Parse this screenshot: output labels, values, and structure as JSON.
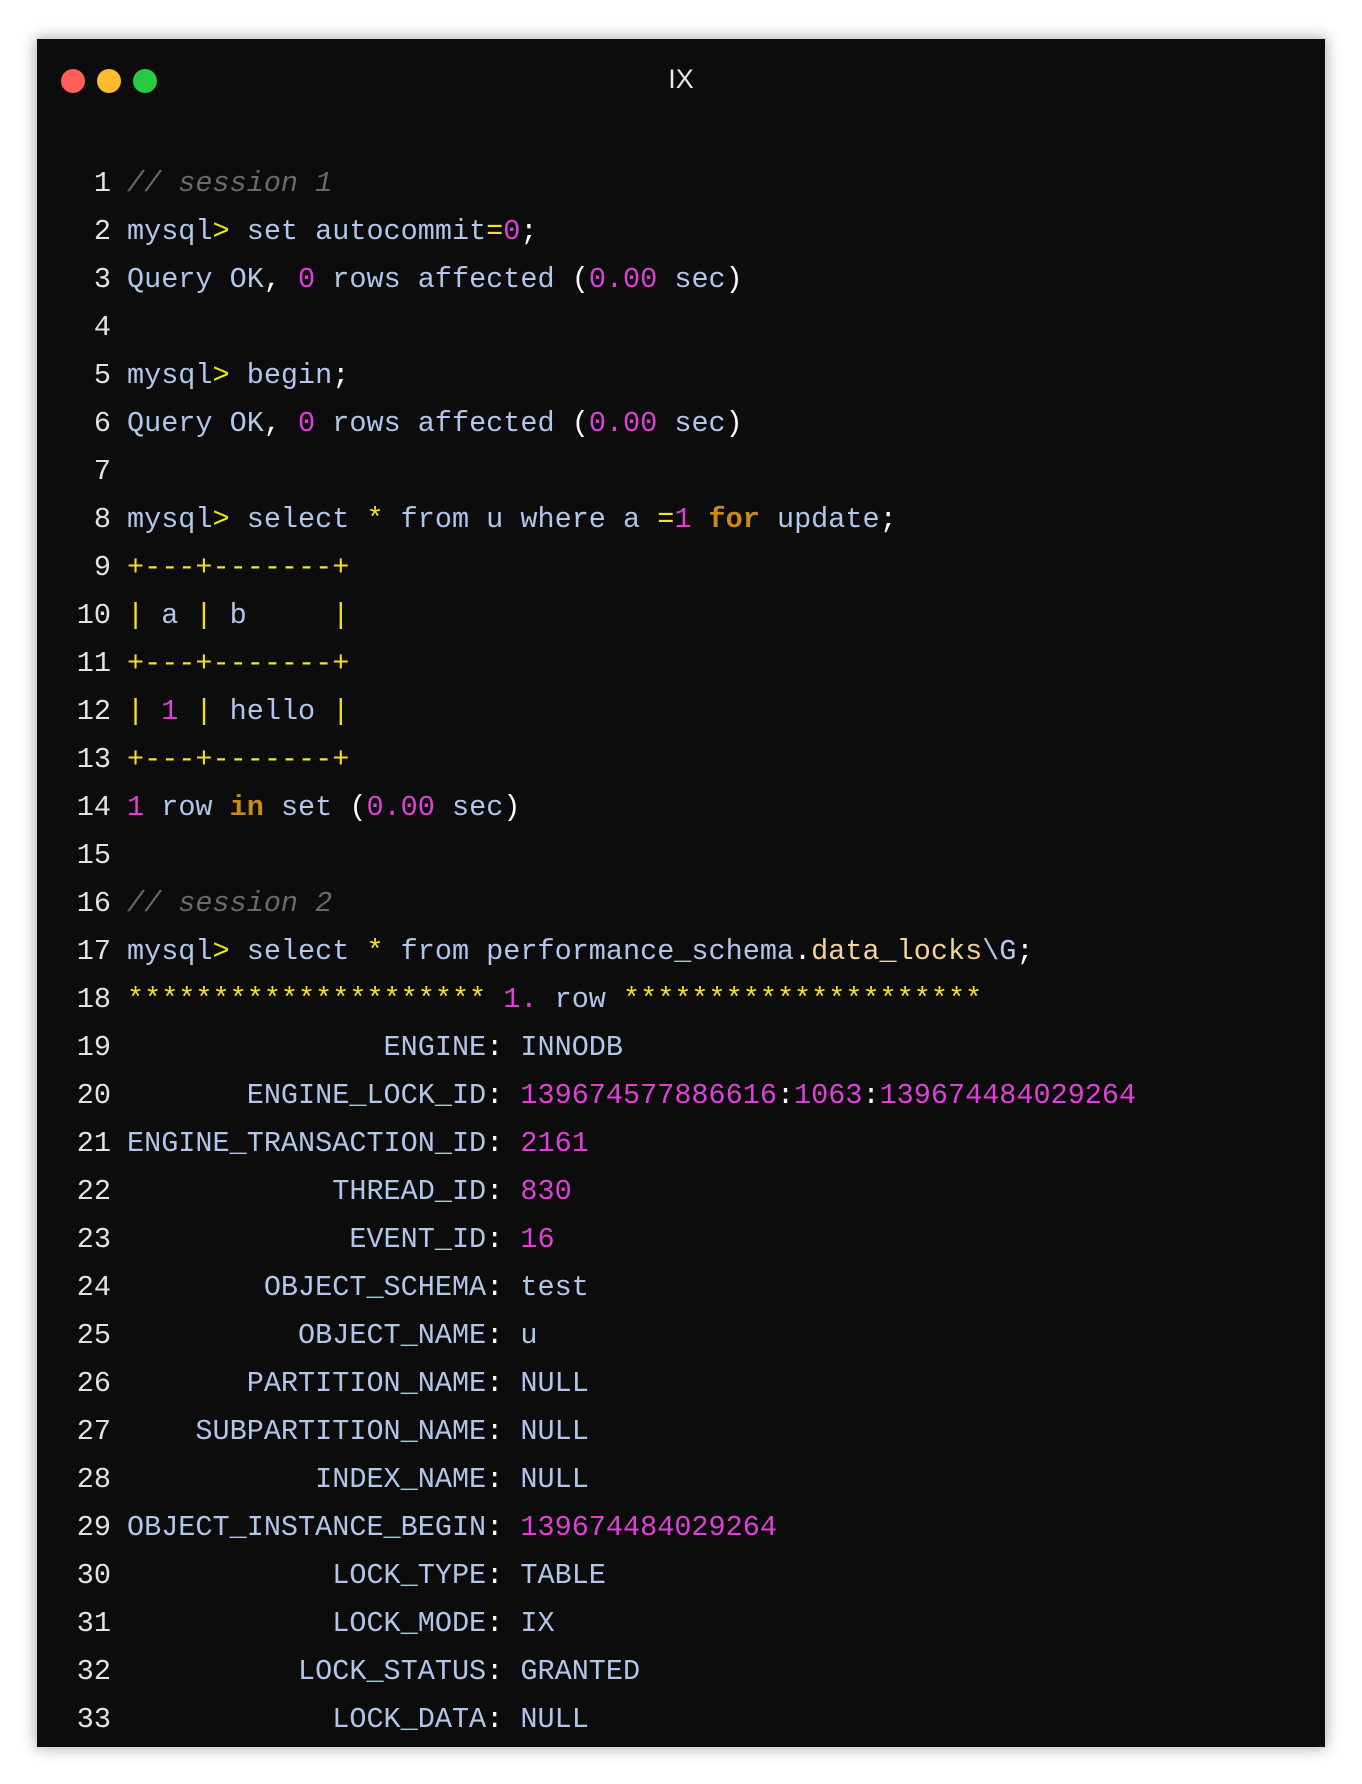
{
  "window": {
    "title": "IX",
    "controls": [
      {
        "name": "close",
        "color": "#fe5f57"
      },
      {
        "name": "minimize",
        "color": "#febc2e"
      },
      {
        "name": "maximize",
        "color": "#28c840"
      }
    ]
  },
  "lines": [
    [
      [
        "comment",
        "// session 1"
      ]
    ],
    [
      [
        "plain",
        "mysql"
      ],
      [
        "op",
        ">"
      ],
      [
        "plain",
        " set autocommit"
      ],
      [
        "op",
        "="
      ],
      [
        "num",
        "0"
      ],
      [
        "punct",
        ";"
      ]
    ],
    [
      [
        "plain",
        "Query OK"
      ],
      [
        "punct",
        ", "
      ],
      [
        "num",
        "0"
      ],
      [
        "plain",
        " rows affected "
      ],
      [
        "punct",
        "("
      ],
      [
        "num",
        "0.00"
      ],
      [
        "plain",
        " sec"
      ],
      [
        "punct",
        ")"
      ]
    ],
    [],
    [
      [
        "plain",
        "mysql"
      ],
      [
        "op",
        ">"
      ],
      [
        "plain",
        " begin"
      ],
      [
        "punct",
        ";"
      ]
    ],
    [
      [
        "plain",
        "Query OK"
      ],
      [
        "punct",
        ", "
      ],
      [
        "num",
        "0"
      ],
      [
        "plain",
        " rows affected "
      ],
      [
        "punct",
        "("
      ],
      [
        "num",
        "0.00"
      ],
      [
        "plain",
        " sec"
      ],
      [
        "punct",
        ")"
      ]
    ],
    [],
    [
      [
        "plain",
        "mysql"
      ],
      [
        "op",
        ">"
      ],
      [
        "plain",
        " select "
      ],
      [
        "op",
        "*"
      ],
      [
        "plain",
        " from u where a "
      ],
      [
        "op",
        "="
      ],
      [
        "num",
        "1"
      ],
      [
        "plain",
        " "
      ],
      [
        "kw",
        "for"
      ],
      [
        "plain",
        " update"
      ],
      [
        "punct",
        ";"
      ]
    ],
    [
      [
        "sep",
        "+---+-------+"
      ]
    ],
    [
      [
        "sep",
        "|"
      ],
      [
        "plain",
        " a "
      ],
      [
        "sep",
        "|"
      ],
      [
        "plain",
        " b     "
      ],
      [
        "sep",
        "|"
      ]
    ],
    [
      [
        "sep",
        "+---+-------+"
      ]
    ],
    [
      [
        "sep",
        "|"
      ],
      [
        "plain",
        " "
      ],
      [
        "num",
        "1"
      ],
      [
        "plain",
        " "
      ],
      [
        "sep",
        "|"
      ],
      [
        "plain",
        " hello "
      ],
      [
        "sep",
        "|"
      ]
    ],
    [
      [
        "sep",
        "+---+-------+"
      ]
    ],
    [
      [
        "num",
        "1"
      ],
      [
        "plain",
        " row "
      ],
      [
        "kw",
        "in"
      ],
      [
        "plain",
        " set "
      ],
      [
        "punct",
        "("
      ],
      [
        "num",
        "0.00"
      ],
      [
        "plain",
        " sec"
      ],
      [
        "punct",
        ")"
      ]
    ],
    [],
    [
      [
        "comment",
        "// session 2"
      ]
    ],
    [
      [
        "plain",
        "mysql"
      ],
      [
        "op",
        ">"
      ],
      [
        "plain",
        " select "
      ],
      [
        "op",
        "*"
      ],
      [
        "plain",
        " from performance_schema"
      ],
      [
        "punct",
        "."
      ],
      [
        "prop",
        "data_locks"
      ],
      [
        "plain",
        "\\G"
      ],
      [
        "punct",
        ";"
      ]
    ],
    [
      [
        "op",
        "*********************"
      ],
      [
        "plain",
        " "
      ],
      [
        "num",
        "1."
      ],
      [
        "plain",
        " row "
      ],
      [
        "op",
        "*********************"
      ]
    ],
    [
      [
        "plain",
        "               ENGINE"
      ],
      [
        "punct",
        ":"
      ],
      [
        "plain",
        " INNODB"
      ]
    ],
    [
      [
        "plain",
        "       ENGINE_LOCK_ID"
      ],
      [
        "punct",
        ":"
      ],
      [
        "plain",
        " "
      ],
      [
        "num",
        "139674577886616"
      ],
      [
        "punct",
        ":"
      ],
      [
        "num",
        "1063"
      ],
      [
        "punct",
        ":"
      ],
      [
        "num",
        "139674484029264"
      ]
    ],
    [
      [
        "plain",
        "ENGINE_TRANSACTION_ID"
      ],
      [
        "punct",
        ":"
      ],
      [
        "plain",
        " "
      ],
      [
        "num",
        "2161"
      ]
    ],
    [
      [
        "plain",
        "            THREAD_ID"
      ],
      [
        "punct",
        ":"
      ],
      [
        "plain",
        " "
      ],
      [
        "num",
        "830"
      ]
    ],
    [
      [
        "plain",
        "             EVENT_ID"
      ],
      [
        "punct",
        ":"
      ],
      [
        "plain",
        " "
      ],
      [
        "num",
        "16"
      ]
    ],
    [
      [
        "plain",
        "        OBJECT_SCHEMA"
      ],
      [
        "punct",
        ":"
      ],
      [
        "plain",
        " test"
      ]
    ],
    [
      [
        "plain",
        "          OBJECT_NAME"
      ],
      [
        "punct",
        ":"
      ],
      [
        "plain",
        " u"
      ]
    ],
    [
      [
        "plain",
        "       PARTITION_NAME"
      ],
      [
        "punct",
        ":"
      ],
      [
        "plain",
        " NULL"
      ]
    ],
    [
      [
        "plain",
        "    SUBPARTITION_NAME"
      ],
      [
        "punct",
        ":"
      ],
      [
        "plain",
        " NULL"
      ]
    ],
    [
      [
        "plain",
        "           INDEX_NAME"
      ],
      [
        "punct",
        ":"
      ],
      [
        "plain",
        " NULL"
      ]
    ],
    [
      [
        "plain",
        "OBJECT_INSTANCE_BEGIN"
      ],
      [
        "punct",
        ":"
      ],
      [
        "plain",
        " "
      ],
      [
        "num",
        "139674484029264"
      ]
    ],
    [
      [
        "plain",
        "            LOCK_TYPE"
      ],
      [
        "punct",
        ":"
      ],
      [
        "plain",
        " TABLE"
      ]
    ],
    [
      [
        "plain",
        "            LOCK_MODE"
      ],
      [
        "punct",
        ":"
      ],
      [
        "plain",
        " IX"
      ]
    ],
    [
      [
        "plain",
        "          LOCK_STATUS"
      ],
      [
        "punct",
        ":"
      ],
      [
        "plain",
        " GRANTED"
      ]
    ],
    [
      [
        "plain",
        "            LOCK_DATA"
      ],
      [
        "punct",
        ":"
      ],
      [
        "plain",
        " NULL"
      ]
    ]
  ]
}
